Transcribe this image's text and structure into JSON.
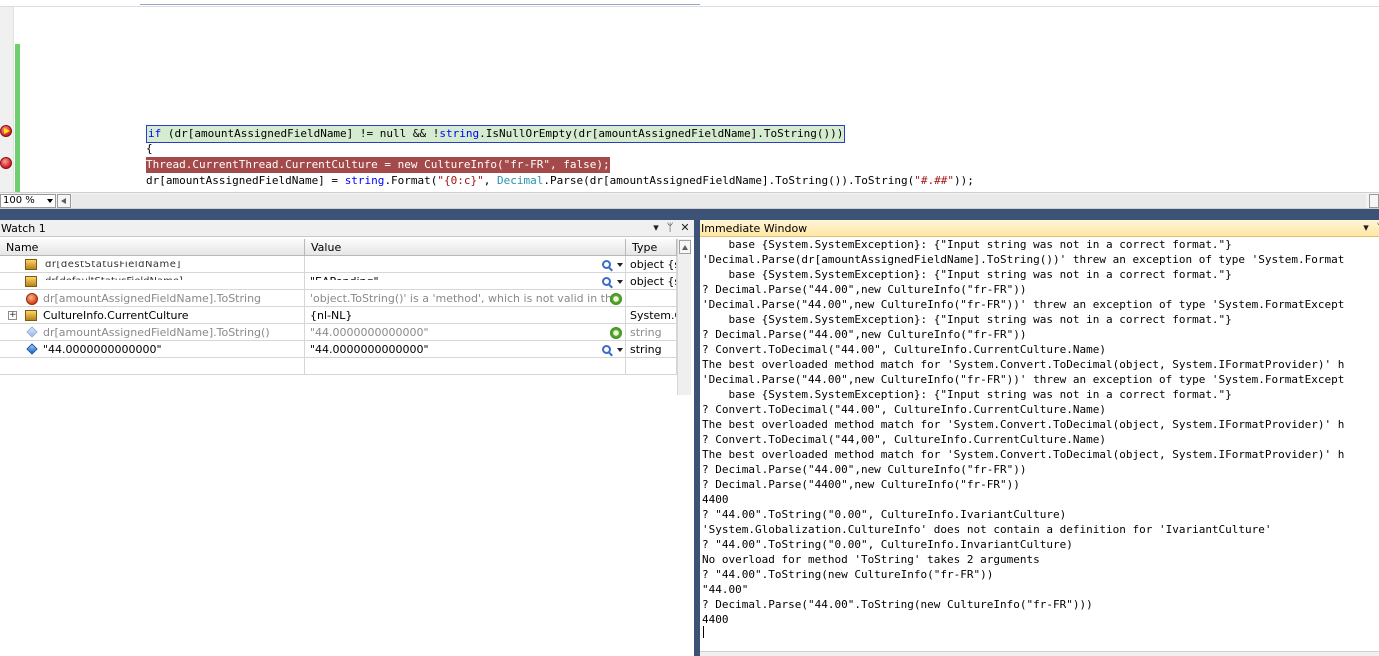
{
  "editor": {
    "code_lines": [
      "if (dr[amountAssignedFieldName] != null && !string.IsNullOrEmpty(dr[amountAssignedFieldName].ToString()))",
      "{",
      "Thread.CurrentThread.CurrentCulture = new CultureInfo(\"fr-FR\", false);",
      "dr[amountAssignedFieldName] = string.Format(\"{0:c}\", Decimal.Parse(dr[amountAssignedFieldName].ToString()).ToString(\"#.##\"));"
    ],
    "tokens": {
      "if": "if",
      "line1_rest": " (dr[amountAssignedFieldName] != null && !",
      "string": "string",
      "line1_tail": ".IsNullOrEmpty(dr[amountAssignedFieldName].ToString()))",
      "brace": "{",
      "l4_a": "dr[amountAssignedFieldName] = ",
      "l4_string": "string",
      "l4_b": ".Format(",
      "l4_str1": "\"{0:c}\"",
      "l4_c": ", ",
      "l4_decimal": "Decimal",
      "l4_d": ".Parse(dr[amountAssignedFieldName].ToString()).ToString(",
      "l4_str2": "\"#.##\"",
      "l4_e": "));"
    },
    "zoom_level": "100 %"
  },
  "watch": {
    "title": "Watch 1",
    "columns": [
      "Name",
      "Value",
      "Type"
    ],
    "rows": [
      {
        "name": "dr[destStatusFieldName]",
        "value": "",
        "type": "object {s",
        "icon": "object-icon"
      },
      {
        "name": "dr[defaultStatusFieldName]",
        "value": "\"EAPending\"",
        "type": "object {s",
        "icon": "object-icon"
      },
      {
        "name": "dr[amountAssignedFieldName].ToString",
        "value": "'object.ToString()' is a 'method', which is not valid in the",
        "type": "",
        "icon": "error-icon"
      },
      {
        "name": "CultureInfo.CurrentCulture",
        "value": "{nl-NL}",
        "type": "System.C",
        "icon": "object-icon"
      },
      {
        "name": "dr[amountAssignedFieldName].ToString()",
        "value": "\"44.0000000000000\"",
        "type": "string",
        "icon": "field-icon"
      },
      {
        "name": "\"44.0000000000000\"",
        "value": "\"44.0000000000000\"",
        "type": "string",
        "icon": "field-icon"
      }
    ]
  },
  "immediate": {
    "title": "Immediate Window",
    "lines": [
      "    base {System.SystemException}: {\"Input string was not in a correct format.\"}",
      "'Decimal.Parse(dr[amountAssignedFieldName].ToString())' threw an exception of type 'System.Format",
      "    base {System.SystemException}: {\"Input string was not in a correct format.\"}",
      "? Decimal.Parse(\"44.00\",new CultureInfo(\"fr-FR\"))",
      "'Decimal.Parse(\"44.00\",new CultureInfo(\"fr-FR\"))' threw an exception of type 'System.FormatExcept",
      "    base {System.SystemException}: {\"Input string was not in a correct format.\"}",
      "? Decimal.Parse(\"44.00\",new CultureInfo(\"fr-FR\"))",
      "? Convert.ToDecimal(\"44.00\", CultureInfo.CurrentCulture.Name)",
      "The best overloaded method match for 'System.Convert.ToDecimal(object, System.IFormatProvider)' h",
      "'Decimal.Parse(\"44.00\",new CultureInfo(\"fr-FR\"))' threw an exception of type 'System.FormatExcept",
      "    base {System.SystemException}: {\"Input string was not in a correct format.\"}",
      "? Convert.ToDecimal(\"44.00\", CultureInfo.CurrentCulture.Name)",
      "The best overloaded method match for 'System.Convert.ToDecimal(object, System.IFormatProvider)' h",
      "? Convert.ToDecimal(\"44,00\", CultureInfo.CurrentCulture.Name)",
      "The best overloaded method match for 'System.Convert.ToDecimal(object, System.IFormatProvider)' h",
      "? Decimal.Parse(\"44.00\",new CultureInfo(\"fr-FR\"))",
      "? Decimal.Parse(\"4400\",new CultureInfo(\"fr-FR\"))",
      "4400",
      "? \"44.00\".ToString(\"0.00\", CultureInfo.IvariantCulture)",
      "'System.Globalization.CultureInfo' does not contain a definition for 'IvariantCulture'",
      "? \"44.00\".ToString(\"0.00\", CultureInfo.InvariantCulture)",
      "No overload for method 'ToString' takes 2 arguments",
      "? \"44.00\".ToString(new CultureInfo(\"fr-FR\"))",
      "\"44.00\"",
      "? Decimal.Parse(\"44.00\".ToString(new CultureInfo(\"fr-FR\")))",
      "4400"
    ]
  }
}
